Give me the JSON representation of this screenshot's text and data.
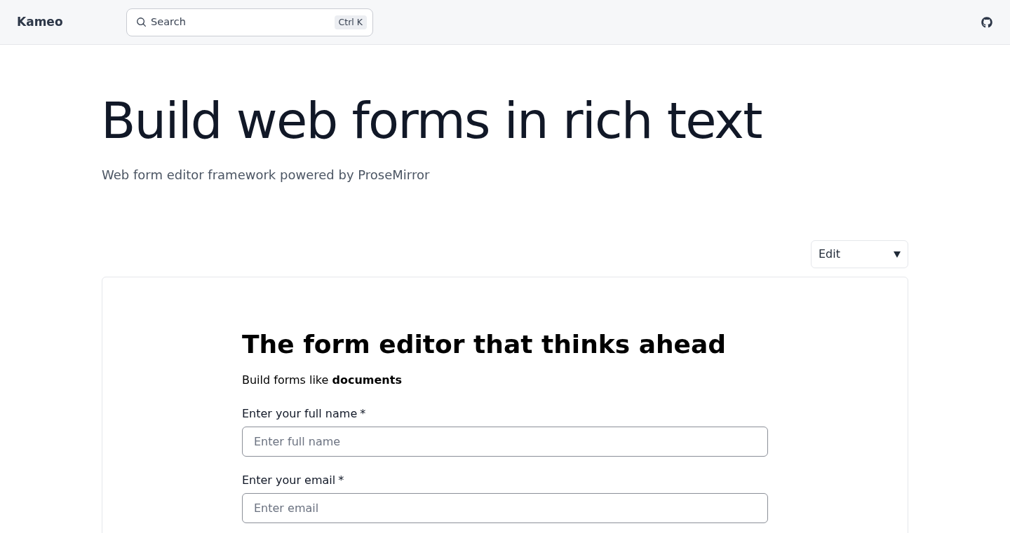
{
  "header": {
    "logo": "Kameo",
    "search": {
      "placeholder": "Search",
      "shortcut": "Ctrl K"
    }
  },
  "hero": {
    "title": "Build web forms in rich text",
    "subtitle": "Web form editor framework powered by ProseMirror"
  },
  "mode_select": {
    "value": "Edit"
  },
  "editor": {
    "heading": "The form editor that thinks ahead",
    "intro": "Build forms like **documents**",
    "fields": [
      {
        "label": "Enter your full name",
        "required_mark": "*",
        "placeholder": "Enter full name"
      },
      {
        "label": "Enter your email",
        "required_mark": "*",
        "placeholder": "Enter email"
      }
    ]
  }
}
